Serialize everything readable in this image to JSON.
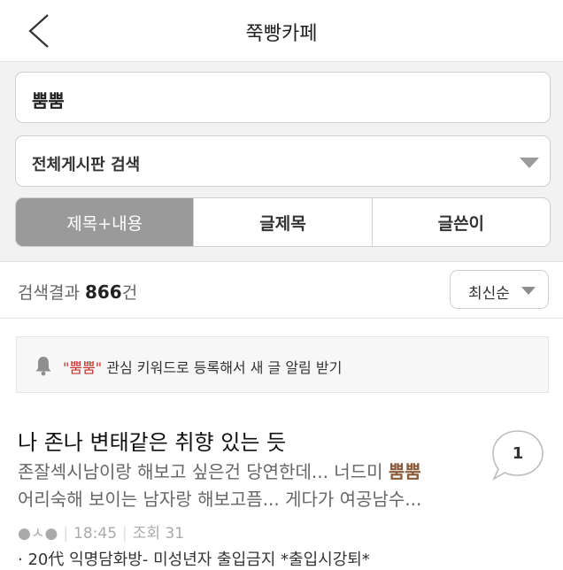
{
  "header": {
    "title": "쭉빵카페"
  },
  "search": {
    "query": "뿜뿜",
    "board_select": "전체게시판 검색"
  },
  "tabs": [
    {
      "label": "제목+내용"
    },
    {
      "label": "글제목"
    },
    {
      "label": "글쓴이"
    }
  ],
  "results": {
    "prefix": "검색결과",
    "count": "866",
    "suffix": "건",
    "sort_label": "최신순"
  },
  "keyword_alert": {
    "keyword": "\"뿜뿜\"",
    "message": " 관심 키워드로 등록해서 새 글 알림 받기"
  },
  "post": {
    "title": "나 존나 변태같은 취향 있는 듯",
    "line1_pre": "존잘섹시남이랑 해보고 싶은건 당연한데... 너드미 ",
    "line1_hl": "뿜뿜",
    "line2": "어리숙해 보이는 남자랑 해보고픔... 게다가 여공남수...",
    "author": "●ㅅ●",
    "time": "18:45",
    "views": "조회 31",
    "board": "· 20代 익명담화방- 미성년자 출입금지 *출입시강퇴*",
    "comment_count": "1"
  },
  "colors": {
    "accent_keyword": "#c4302b",
    "highlight": "#8a5a3a",
    "tab_active_bg": "#9a9a9a"
  },
  "icons": {
    "back": "chevron-left-icon",
    "dropdown": "triangle-down-icon",
    "bell": "bell-icon",
    "comment": "speech-bubble-icon"
  }
}
